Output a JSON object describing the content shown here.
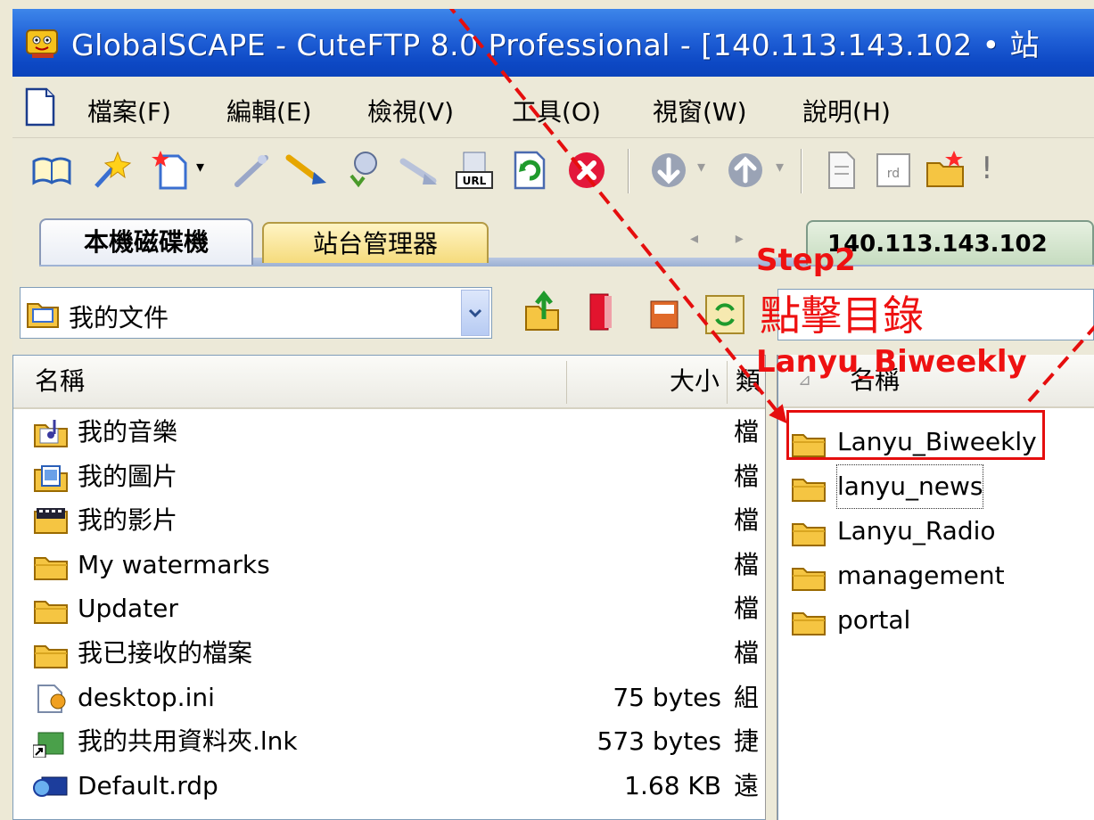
{
  "window": {
    "title": "GlobalSCAPE - CuteFTP 8.0 Professional - [140.113.143.102 • 站"
  },
  "menu": [
    "檔案(F)",
    "編輯(E)",
    "檢視(V)",
    "工具(O)",
    "視窗(W)",
    "說明(H)"
  ],
  "tabs": {
    "local": "本機磁碟機",
    "site_manager": "站台管理器",
    "remote": "140.113.143.102"
  },
  "local": {
    "path": "我的文件",
    "columns": {
      "name": "名稱",
      "size": "大小",
      "type": "類"
    },
    "rows": [
      {
        "name": "我的音樂",
        "size": "",
        "type": "檔",
        "icon": "music-folder-icon"
      },
      {
        "name": "我的圖片",
        "size": "",
        "type": "檔",
        "icon": "pictures-folder-icon"
      },
      {
        "name": "我的影片",
        "size": "",
        "type": "檔",
        "icon": "video-folder-icon"
      },
      {
        "name": "My watermarks",
        "size": "",
        "type": "檔",
        "icon": "folder-icon"
      },
      {
        "name": "Updater",
        "size": "",
        "type": "檔",
        "icon": "folder-icon"
      },
      {
        "name": "我已接收的檔案",
        "size": "",
        "type": "檔",
        "icon": "folder-icon"
      },
      {
        "name": "desktop.ini",
        "size": "75 bytes",
        "type": "組",
        "icon": "settings-file-icon"
      },
      {
        "name": "我的共用資料夾.lnk",
        "size": "573 bytes",
        "type": "捷",
        "icon": "shortcut-icon"
      },
      {
        "name": "Default.rdp",
        "size": "1.68 KB",
        "type": "遠",
        "icon": "rdp-file-icon"
      }
    ]
  },
  "remote": {
    "columns": {
      "name": "名稱"
    },
    "rows": [
      {
        "name": "Lanyu_Biweekly",
        "icon": "folder-icon"
      },
      {
        "name": "lanyu_news",
        "icon": "folder-icon"
      },
      {
        "name": "Lanyu_Radio",
        "icon": "folder-icon"
      },
      {
        "name": "management",
        "icon": "folder-icon"
      },
      {
        "name": "portal",
        "icon": "folder-icon"
      }
    ]
  },
  "annotation": {
    "step": "Step2",
    "instruction": "點擊目錄",
    "target": "Lanyu_Biweekly",
    "color": "#ee1111"
  },
  "colors": {
    "titlebar": "#1f5fd6",
    "chrome": "#ece9d8",
    "annotation": "#e50e0e"
  }
}
